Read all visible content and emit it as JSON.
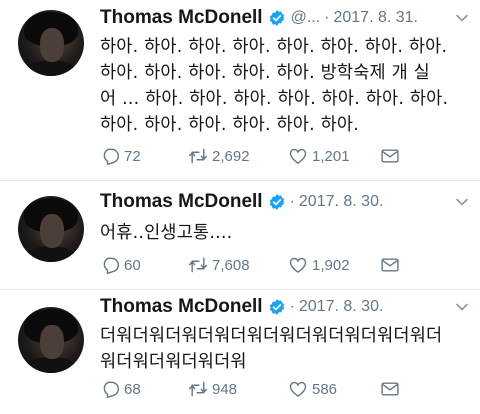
{
  "colors": {
    "verified": "#1da1f2",
    "muted": "#657786",
    "text": "#14171a"
  },
  "tweets": [
    {
      "name": "Thomas McDonell",
      "handle": "@...",
      "date": "2017. 8. 31.",
      "text": "하아. 하아. 하아. 하아. 하아. 하아. 하아. 하아.\n하아. 하아. 하아. 하아. 하아. 방학숙제 개 실\n어 ... 하아. 하아. 하아. 하아. 하아. 하아. 하아.\n하아. 하아. 하아. 하아. 하아. 하아.",
      "replies": "72",
      "retweets": "2,692",
      "likes": "1,201"
    },
    {
      "name": "Thomas McDonell",
      "date": "2017. 8. 30.",
      "text": "어휴..인생고통....",
      "replies": "60",
      "retweets": "7,608",
      "likes": "1,902"
    },
    {
      "name": "Thomas McDonell",
      "date": "2017. 8. 30.",
      "text": "더워더워더워더워더워더워더워더워더워더워더\n워더워더워더워더워",
      "replies": "68",
      "retweets": "948",
      "likes": "586"
    }
  ]
}
